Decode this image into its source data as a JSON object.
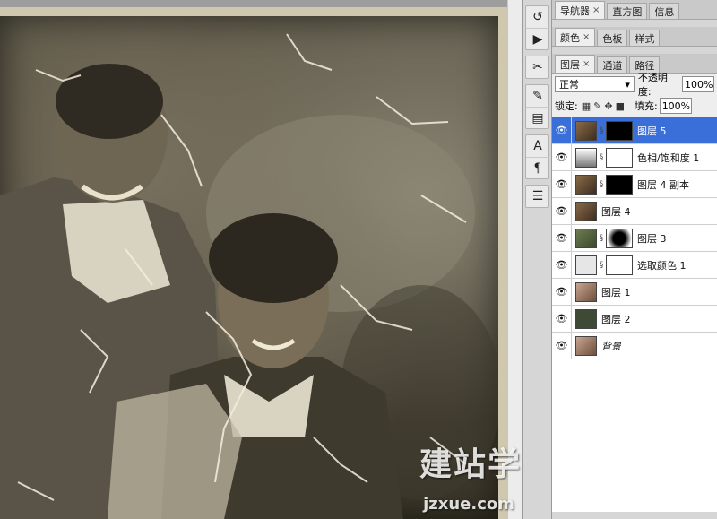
{
  "panels": {
    "top_tabs": [
      {
        "label": "导航器",
        "closable": true,
        "active": true
      },
      {
        "label": "直方图",
        "closable": false,
        "active": false
      },
      {
        "label": "信息",
        "closable": false,
        "active": false
      }
    ],
    "color_tabs": [
      {
        "label": "颜色",
        "closable": true,
        "active": true
      },
      {
        "label": "色板",
        "closable": false,
        "active": false
      },
      {
        "label": "样式",
        "closable": false,
        "active": false
      }
    ],
    "layer_tabs": [
      {
        "label": "图层",
        "closable": true,
        "active": true
      },
      {
        "label": "通道",
        "closable": false,
        "active": false
      },
      {
        "label": "路径",
        "closable": false,
        "active": false
      }
    ],
    "blend_mode": "正常",
    "opacity_label": "不透明度:",
    "opacity_value": "100%",
    "lock_label": "锁定:",
    "fill_label": "填充:",
    "fill_value": "100%",
    "layers": [
      {
        "name": "图层 5",
        "selected": true,
        "thumb": "photo",
        "mask": "black"
      },
      {
        "name": "色相/饱和度 1",
        "selected": false,
        "thumb": "adjust-hue",
        "mask": "white"
      },
      {
        "name": "图层 4 副本",
        "selected": false,
        "thumb": "photo",
        "mask": "black"
      },
      {
        "name": "图层 4",
        "selected": false,
        "thumb": "photo",
        "mask": ""
      },
      {
        "name": "图层 3",
        "selected": false,
        "thumb": "green",
        "mask": "vignette"
      },
      {
        "name": "选取颜色 1",
        "selected": false,
        "thumb": "adjust-select",
        "mask": "white"
      },
      {
        "name": "图层 1",
        "selected": false,
        "thumb": "people",
        "mask": ""
      },
      {
        "name": "图层 2",
        "selected": false,
        "thumb": "darkgreen",
        "mask": ""
      },
      {
        "name": "背景",
        "selected": false,
        "thumb": "people",
        "mask": "",
        "italic": true
      }
    ]
  },
  "dock": {
    "icons": [
      "history-icon",
      "actions-icon",
      "tool-presets-icon",
      "brushes-icon",
      "clone-source-icon",
      "character-icon",
      "paragraph-icon",
      "notes-icon"
    ]
  },
  "watermark": {
    "cn": "建站学",
    "url": "jzxue.com"
  },
  "colors": {
    "selection": "#3a6fd9",
    "panel_bg": "#d6d6d6"
  }
}
